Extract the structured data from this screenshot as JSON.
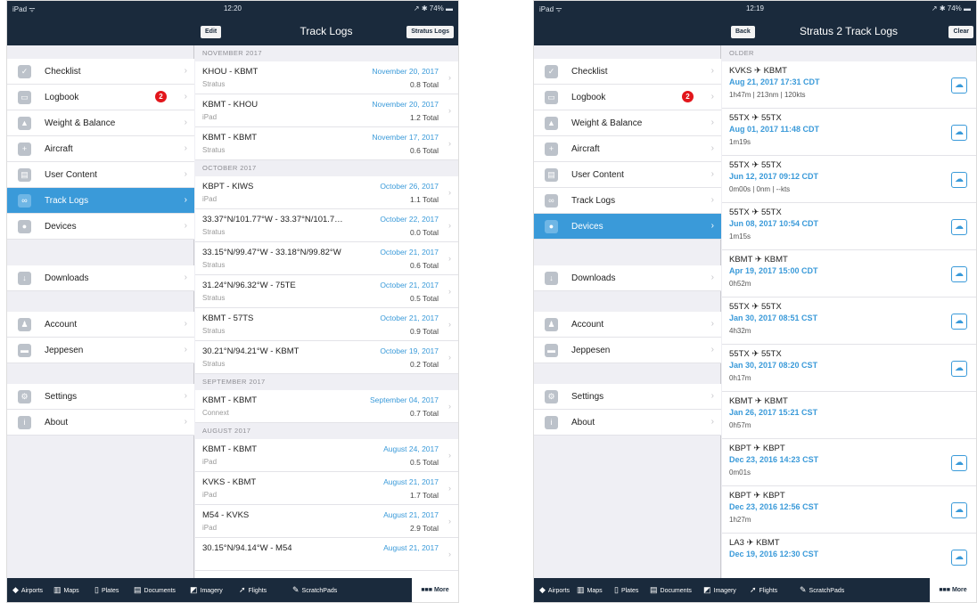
{
  "left": {
    "status": {
      "device": "iPad ᯤ",
      "time": "12:20",
      "battery": "↗ ✱ 74% ▬"
    },
    "nav": {
      "edit": "Edit",
      "title": "Track Logs",
      "stratus": "Stratus Logs"
    },
    "sidebar": [
      {
        "label": "Checklist",
        "icon": "✓"
      },
      {
        "label": "Logbook",
        "icon": "▭",
        "badge": "2"
      },
      {
        "label": "Weight & Balance",
        "icon": "▲"
      },
      {
        "label": "Aircraft",
        "icon": "+"
      },
      {
        "label": "User Content",
        "icon": "▤"
      },
      {
        "label": "Track Logs",
        "icon": "∞"
      },
      {
        "label": "Devices",
        "icon": "●"
      },
      {
        "label": "Downloads",
        "icon": "↓"
      },
      {
        "label": "Account",
        "icon": "♟"
      },
      {
        "label": "Jeppesen",
        "icon": "▬"
      },
      {
        "label": "Settings",
        "icon": "⚙"
      },
      {
        "label": "About",
        "icon": "i"
      }
    ],
    "sections": [
      {
        "title": "NOVEMBER 2017",
        "logs": [
          {
            "route": "KHOU - KBMT",
            "date": "November 20, 2017",
            "source": "Stratus",
            "total": "0.8 Total"
          },
          {
            "route": "KBMT - KHOU",
            "date": "November 20, 2017",
            "source": "iPad",
            "total": "1.2 Total"
          },
          {
            "route": "KBMT - KBMT",
            "date": "November 17, 2017",
            "source": "Stratus",
            "total": "0.6 Total"
          }
        ]
      },
      {
        "title": "OCTOBER 2017",
        "logs": [
          {
            "route": "KBPT - KIWS",
            "date": "October 26, 2017",
            "source": "iPad",
            "total": "1.1 Total"
          },
          {
            "route": "33.37°N/101.77°W - 33.37°N/101.7…",
            "date": "October 22, 2017",
            "source": "Stratus",
            "total": "0.0 Total"
          },
          {
            "route": "33.15°N/99.47°W - 33.18°N/99.82°W",
            "date": "October 21, 2017",
            "source": "Stratus",
            "total": "0.6 Total"
          },
          {
            "route": "31.24°N/96.32°W - 75TE",
            "date": "October 21, 2017",
            "source": "Stratus",
            "total": "0.5 Total"
          },
          {
            "route": "KBMT - 57TS",
            "date": "October 21, 2017",
            "source": "Stratus",
            "total": "0.9 Total"
          },
          {
            "route": "30.21°N/94.21°W - KBMT",
            "date": "October 19, 2017",
            "source": "Stratus",
            "total": "0.2 Total"
          }
        ]
      },
      {
        "title": "SEPTEMBER 2017",
        "logs": [
          {
            "route": "KBMT - KBMT",
            "date": "September 04, 2017",
            "source": "Connext",
            "total": "0.7 Total"
          }
        ]
      },
      {
        "title": "AUGUST 2017",
        "logs": [
          {
            "route": "KBMT - KBMT",
            "date": "August 24, 2017",
            "source": "iPad",
            "total": "0.5 Total"
          },
          {
            "route": "KVKS - KBMT",
            "date": "August 21, 2017",
            "source": "iPad",
            "total": "1.7 Total"
          },
          {
            "route": "M54 - KVKS",
            "date": "August 21, 2017",
            "source": "iPad",
            "total": "2.9 Total"
          },
          {
            "route": "30.15°N/94.14°W - M54",
            "date": "August 21, 2017",
            "source": "",
            "total": ""
          }
        ]
      }
    ]
  },
  "right": {
    "status": {
      "device": "iPad ᯤ",
      "time": "12:19",
      "battery": "↗ ✱ 74% ▬"
    },
    "nav": {
      "back": "Back",
      "title": "Stratus 2 Track Logs",
      "clear": "Clear"
    },
    "section": "OLDER",
    "logs": [
      {
        "route": "KVKS ✈ KBMT",
        "date": "Aug 21, 2017 17:31 CDT",
        "stats": "1h47m | 213nm | 120kts",
        "cloud": true
      },
      {
        "route": "55TX ✈ 55TX",
        "date": "Aug 01, 2017 11:48 CDT",
        "stats": "1m19s",
        "cloud": true
      },
      {
        "route": "55TX ✈ 55TX",
        "date": "Jun 12, 2017 09:12 CDT",
        "stats": "0m00s | 0nm | --kts",
        "cloud": true
      },
      {
        "route": "55TX ✈ 55TX",
        "date": "Jun 08, 2017 10:54 CDT",
        "stats": "1m15s",
        "cloud": true
      },
      {
        "route": "KBMT ✈ KBMT",
        "date": "Apr 19, 2017 15:00 CDT",
        "stats": "0h52m",
        "cloud": true
      },
      {
        "route": "55TX ✈ 55TX",
        "date": "Jan 30, 2017 08:51 CST",
        "stats": "4h32m",
        "cloud": true
      },
      {
        "route": "55TX ✈ 55TX",
        "date": "Jan 30, 2017 08:20 CST",
        "stats": "0h17m",
        "cloud": true
      },
      {
        "route": "KBMT ✈ KBMT",
        "date": "Jan 26, 2017 15:21 CST",
        "stats": "0h57m",
        "cloud": false
      },
      {
        "route": "KBPT ✈ KBPT",
        "date": "Dec 23, 2016 14:23 CST",
        "stats": "0m01s",
        "cloud": true
      },
      {
        "route": "KBPT ✈ KBPT",
        "date": "Dec 23, 2016 12:56 CST",
        "stats": "1h27m",
        "cloud": true
      },
      {
        "route": "LA3 ✈ KBMT",
        "date": "Dec 19, 2016 12:30 CST",
        "stats": "",
        "cloud": true
      }
    ]
  },
  "tabbar": [
    {
      "icon": "◆",
      "label": "Airports"
    },
    {
      "icon": "▥",
      "label": "Maps"
    },
    {
      "icon": "▯",
      "label": "Plates"
    },
    {
      "icon": "▤",
      "label": "Documents"
    },
    {
      "icon": "◩",
      "label": "Imagery"
    },
    {
      "icon": "➚",
      "label": "Flights"
    },
    {
      "icon": "✎",
      "label": "ScratchPads"
    },
    {
      "icon": "■■■",
      "label": "More"
    }
  ]
}
